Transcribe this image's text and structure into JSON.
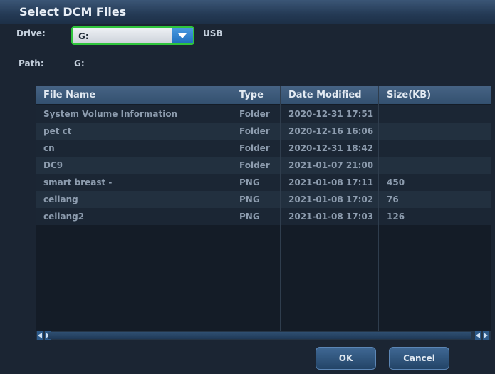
{
  "dialog": {
    "title": "Select DCM Files"
  },
  "drive": {
    "label": "Drive:",
    "value": "G:",
    "type": "USB"
  },
  "path": {
    "label": "Path:",
    "value": "G:"
  },
  "table": {
    "columns": [
      "File Name",
      "Type",
      "Date Modified",
      "Size(KB)"
    ],
    "rows": [
      {
        "name": "System Volume Information",
        "type": "Folder",
        "date": "2020-12-31 17:51",
        "size": ""
      },
      {
        "name": "pet ct",
        "type": "Folder",
        "date": "2020-12-16 16:06",
        "size": ""
      },
      {
        "name": "cn",
        "type": "Folder",
        "date": "2020-12-31 18:42",
        "size": ""
      },
      {
        "name": "DC9",
        "type": "Folder",
        "date": "2021-01-07 21:00",
        "size": ""
      },
      {
        "name": "smart breast -",
        "type": "PNG",
        "date": "2021-01-08 17:11",
        "size": "450"
      },
      {
        "name": "celiang",
        "type": "PNG",
        "date": "2021-01-08 17:02",
        "size": "76"
      },
      {
        "name": "celiang2",
        "type": "PNG",
        "date": "2021-01-08 17:03",
        "size": "126"
      }
    ]
  },
  "buttons": {
    "ok": "OK",
    "cancel": "Cancel"
  },
  "colors": {
    "focus_border": "#2fc53c",
    "accent": "#1f6fbf"
  }
}
